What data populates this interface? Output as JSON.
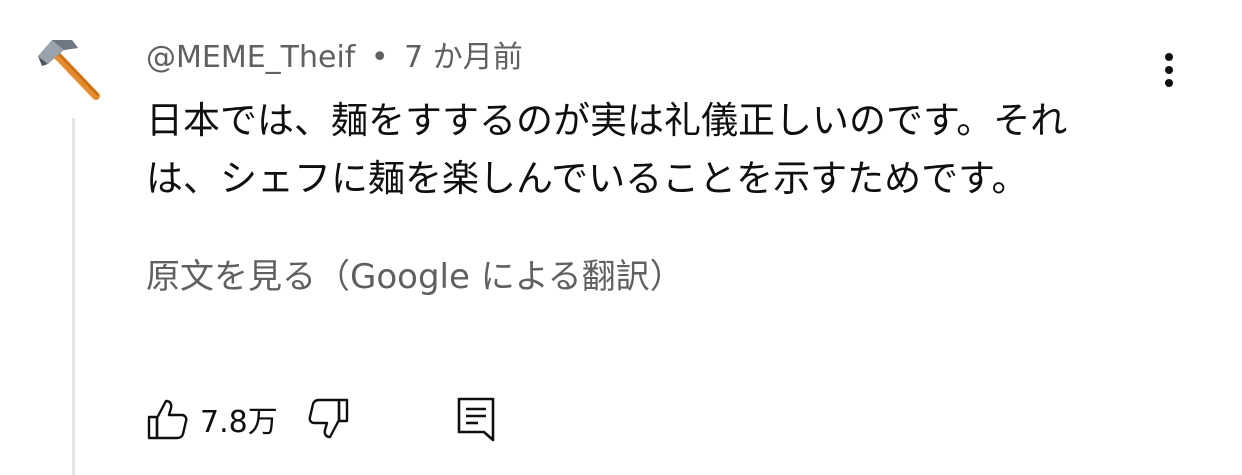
{
  "comment": {
    "author": "@MEME_Theif",
    "separator": "•",
    "timestamp": "7 か月前",
    "text_line1": "日本では、麺をすするのが実は礼儀正しいのです。それ",
    "text_line2": "は、シェフに麺を楽しんでいることを示すためです。",
    "translate_link": "原文を見る（Google による翻訳）",
    "avatar_icon": "hammer-icon",
    "like_count": "7.8万"
  },
  "icons": {
    "menu": "more-vertical-icon",
    "like": "thumbs-up-icon",
    "dislike": "thumbs-down-icon",
    "reply": "reply-comment-icon"
  }
}
